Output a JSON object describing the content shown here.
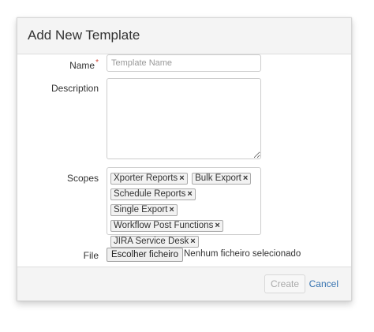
{
  "dialog": {
    "title": "Add New Template"
  },
  "form": {
    "name": {
      "label": "Name",
      "required_mark": "*",
      "placeholder": "Template Name",
      "value": ""
    },
    "description": {
      "label": "Description",
      "value": ""
    },
    "scopes": {
      "label": "Scopes",
      "tags": [
        {
          "label": "Xporter Reports",
          "remove": "×"
        },
        {
          "label": "Bulk Export",
          "remove": "×"
        },
        {
          "label": "Schedule Reports",
          "remove": "×"
        },
        {
          "label": "Single Export",
          "remove": "×"
        },
        {
          "label": "Workflow Post Functions",
          "remove": "×"
        },
        {
          "label": "JIRA Service Desk",
          "remove": "×"
        }
      ]
    },
    "file": {
      "label": "File",
      "button_label": "Escolher ficheiro",
      "status": "Nenhum ficheiro selecionado"
    }
  },
  "footer": {
    "create_label": "Create",
    "cancel_label": "Cancel"
  },
  "colors": {
    "required": "#d04437",
    "link": "#3572b0",
    "disabled_text": "#a9a9a9"
  }
}
